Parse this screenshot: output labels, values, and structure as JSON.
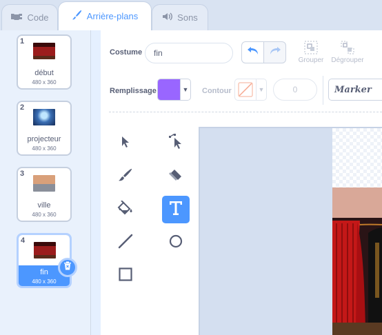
{
  "tabs": [
    {
      "label": "Code",
      "icon": "code-icon",
      "active": false
    },
    {
      "label": "Arrière-plans",
      "icon": "paintbrush-icon",
      "active": true
    },
    {
      "label": "Sons",
      "icon": "speaker-icon",
      "active": false
    }
  ],
  "backdrops": [
    {
      "number": "1",
      "name": "début",
      "size": "480 x 360",
      "thumb_color": "#7a1414"
    },
    {
      "number": "2",
      "name": "projecteur",
      "size": "480 x 360",
      "thumb_color": "#3a6fb5"
    },
    {
      "number": "3",
      "name": "ville",
      "size": "480 x 360",
      "thumb_color": "#c98c5e"
    },
    {
      "number": "4",
      "name": "fin",
      "size": "480 x 360",
      "thumb_color": "#7a1414",
      "selected": true
    }
  ],
  "editor": {
    "costume_label": "Costume",
    "costume_name": "fin",
    "group_label": "Grouper",
    "ungroup_label": "Dégrouper",
    "fill_label": "Remplissage",
    "fill_color": "#9966ff",
    "outline_label": "Contour",
    "stroke_width": "0",
    "font": "Marker"
  },
  "tools": [
    {
      "name": "select-tool",
      "icon": "arrow-icon"
    },
    {
      "name": "reshape-tool",
      "icon": "reshape-icon"
    },
    {
      "name": "brush-tool",
      "icon": "brush-icon"
    },
    {
      "name": "eraser-tool",
      "icon": "eraser-icon"
    },
    {
      "name": "fill-tool",
      "icon": "bucket-icon"
    },
    {
      "name": "text-tool",
      "icon": "text-icon",
      "active": true
    },
    {
      "name": "line-tool",
      "icon": "line-icon"
    },
    {
      "name": "circle-tool",
      "icon": "circle-icon"
    },
    {
      "name": "rectangle-tool",
      "icon": "rectangle-icon"
    }
  ],
  "colors": {
    "accent": "#4c97ff",
    "text": "#575e75"
  }
}
